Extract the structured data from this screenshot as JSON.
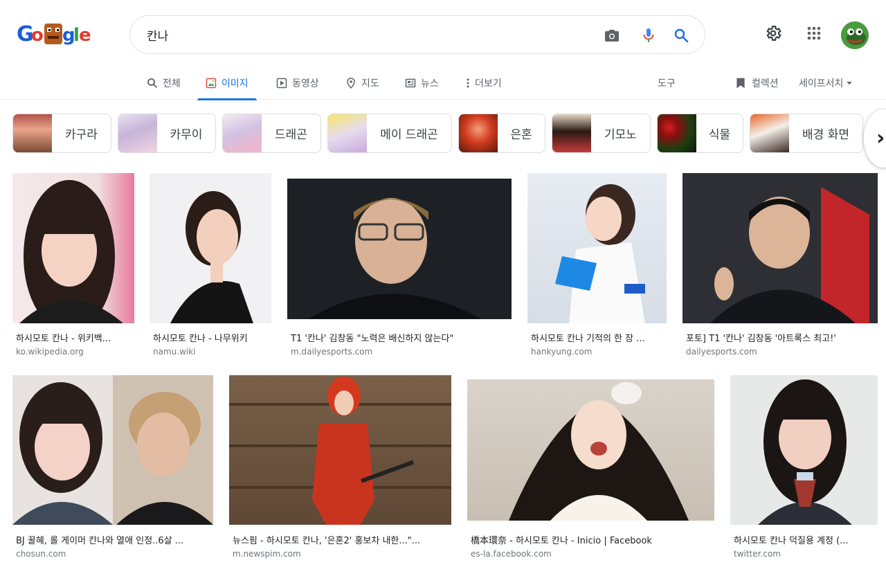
{
  "search": {
    "query": "칸나"
  },
  "colors": {
    "accent": "#1a73e8",
    "mic": "#ea4335",
    "text": "#202124",
    "muted": "#5f6368"
  },
  "header": {
    "logo_letters": [
      "G",
      "o",
      "o",
      "g",
      "l",
      "e"
    ],
    "icons": [
      "camera-icon",
      "microphone-icon",
      "search-icon",
      "settings-icon",
      "apps-grid-icon"
    ]
  },
  "tabs": [
    {
      "label": "전체",
      "icon": "search-icon"
    },
    {
      "label": "이미지",
      "icon": "image-icon",
      "active": true
    },
    {
      "label": "동영상",
      "icon": "play-icon"
    },
    {
      "label": "지도",
      "icon": "map-pin-icon"
    },
    {
      "label": "뉴스",
      "icon": "news-icon"
    },
    {
      "label": "더보기",
      "icon": "more-vert-icon"
    }
  ],
  "tools_label": "도구",
  "collections_label": "컬렉션",
  "safesearch_label": "세이프서치",
  "chips": [
    {
      "label": "카구라"
    },
    {
      "label": "카무이"
    },
    {
      "label": "드래곤"
    },
    {
      "label": "메이 드래곤"
    },
    {
      "label": "은혼"
    },
    {
      "label": "기모노"
    },
    {
      "label": "식물"
    },
    {
      "label": "배경 화면"
    }
  ],
  "results": [
    {
      "title": "하시모토 칸나 - 위키백...",
      "source": "ko.wikipedia.org"
    },
    {
      "title": "하시모토 칸나 - 나무위키",
      "source": "namu.wiki"
    },
    {
      "title": "T1 '칸나' 김창동 \"노력은 배신하지 않는다\"",
      "source": "m.dailyesports.com"
    },
    {
      "title": "하시모토 칸나 기적의 한 장 ...",
      "source": "hankyung.com"
    },
    {
      "title": "포토] T1 '칸나' 김창동 '아트록스 최고!'",
      "source": "dailyesports.com"
    },
    {
      "title": "BJ 꿀혜, 롤 게이머 칸나와 열애 인정..6살 ...",
      "source": "chosun.com"
    },
    {
      "title": "뉴스핌 - 하시모토 칸나, '은혼2' 홍보차 내한...\"...",
      "source": "m.newspim.com"
    },
    {
      "title": "橋本環奈 - 하시모토 칸나 - Inicio | Facebook",
      "source": "es-la.facebook.com"
    },
    {
      "title": "하시모토 칸나 덕질용 계정 (...",
      "source": "twitter.com"
    }
  ]
}
